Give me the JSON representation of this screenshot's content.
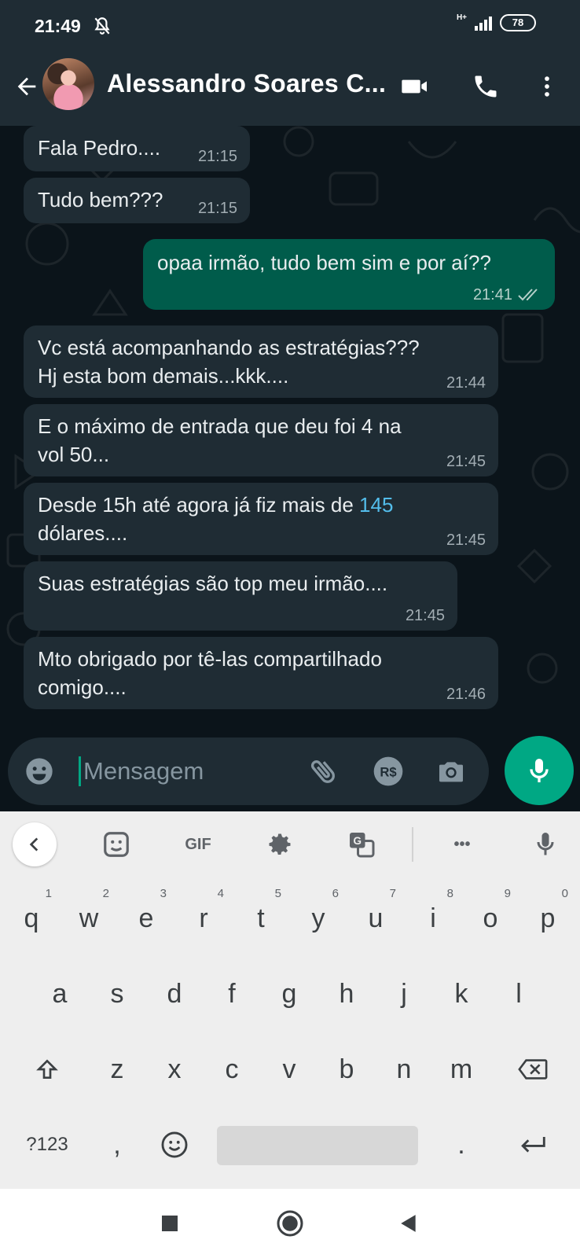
{
  "status_bar": {
    "time": "21:49",
    "network": "H+",
    "battery": "78"
  },
  "header": {
    "contact_name": "Alessandro Soares C..."
  },
  "messages": [
    {
      "direction": "in",
      "text": [
        "Fala Pedro...."
      ],
      "time": "21:15"
    },
    {
      "direction": "in",
      "text": [
        "Tudo bem???"
      ],
      "time": "21:15"
    },
    {
      "direction": "out",
      "text": [
        "opaa irmão, tudo bem sim e por aí??"
      ],
      "time": "21:41",
      "status": "read"
    },
    {
      "direction": "in",
      "text": [
        "Vc está acompanhando as estratégias???",
        "Hj esta bom demais...kkk...."
      ],
      "time": "21:44"
    },
    {
      "direction": "in",
      "text": [
        "E o máximo de entrada que deu foi 4 na",
        "vol 50..."
      ],
      "time": "21:45"
    },
    {
      "direction": "in",
      "text_prefix": "Desde 15h até agora já fiz mais de ",
      "highlight": "145",
      "text": [
        "dólares...."
      ],
      "time": "21:45"
    },
    {
      "direction": "in",
      "text": [
        "Suas estratégias são top meu irmão...."
      ],
      "time": "21:45"
    },
    {
      "direction": "in",
      "text": [
        "Mto obrigado por tê-las compartilhado",
        "comigo...."
      ],
      "time": "21:46"
    }
  ],
  "composer": {
    "placeholder": "Mensagem",
    "value": ""
  },
  "keyboard": {
    "toolbar": {
      "gif_label": "GIF",
      "more_label": "•••"
    },
    "row1": [
      {
        "key": "q",
        "hint": "1"
      },
      {
        "key": "w",
        "hint": "2"
      },
      {
        "key": "e",
        "hint": "3"
      },
      {
        "key": "r",
        "hint": "4"
      },
      {
        "key": "t",
        "hint": "5"
      },
      {
        "key": "y",
        "hint": "6"
      },
      {
        "key": "u",
        "hint": "7"
      },
      {
        "key": "i",
        "hint": "8"
      },
      {
        "key": "o",
        "hint": "9"
      },
      {
        "key": "p",
        "hint": "0"
      }
    ],
    "row2": [
      "a",
      "s",
      "d",
      "f",
      "g",
      "h",
      "j",
      "k",
      "l"
    ],
    "row3": [
      "z",
      "x",
      "c",
      "v",
      "b",
      "n",
      "m"
    ],
    "row4": {
      "symbols": "?123",
      "comma": ",",
      "period": "."
    }
  },
  "colors": {
    "header_bg": "#1f2c34",
    "chat_bg": "#0b141a",
    "incoming_bubble": "#1f2c34",
    "outgoing_bubble": "#005c4b",
    "accent": "#00a884",
    "link": "#53bdeb"
  },
  "icons": {
    "status_bar": [
      "mute-icon",
      "signal-icon",
      "battery-icon"
    ],
    "header": [
      "back-arrow-icon",
      "video-call-icon",
      "phone-icon",
      "more-vert-icon"
    ],
    "composer": [
      "emoji-icon",
      "attach-icon",
      "payment-icon",
      "camera-icon",
      "mic-icon"
    ],
    "keyboard_toolbar": [
      "chevron-left-icon",
      "sticker-icon",
      "settings-icon",
      "translate-icon",
      "more-icon",
      "voice-input-icon"
    ],
    "nav": [
      "recents-icon",
      "home-icon",
      "back-icon"
    ]
  }
}
